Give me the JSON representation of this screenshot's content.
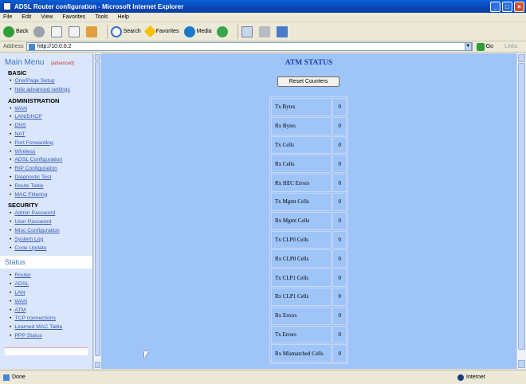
{
  "window": {
    "title": "ADSL Router configuration - Microsoft Internet Explorer"
  },
  "menubar": [
    "File",
    "Edit",
    "View",
    "Favorites",
    "Tools",
    "Help"
  ],
  "toolbar": {
    "back": "Back",
    "search": "Search",
    "favorites": "Favorites",
    "media": "Media"
  },
  "address": {
    "label": "Address",
    "url": "http://10.0.0.2",
    "go": "Go",
    "links": "Links"
  },
  "sidebar": {
    "title": "Main Menu",
    "tag": "(advanced)",
    "basic_label": "BASIC",
    "basic": [
      "One/Page Setup",
      "hide advanced settings"
    ],
    "admin_label": "ADMINISTRATION",
    "admin": [
      "WAN",
      "LAN/DHCP",
      "DNS",
      "NAT",
      "Port Forwarding",
      "Wireless",
      "ADSL Configuration",
      "RIP Configuration",
      "Diagnostic Test",
      "Route Table",
      "MAC Filtering"
    ],
    "security_label": "SECURITY",
    "security": [
      "Admin Password",
      "User Password",
      "Misc Configuration",
      "System Log",
      "Code Update"
    ],
    "status_label": "Status",
    "status": [
      "Router",
      "ADSL",
      "LAN",
      "WAN",
      "ATM",
      "TCP connections",
      "Learned MAC Table",
      "PPP Status"
    ]
  },
  "main": {
    "title": "ATM STATUS",
    "reset_button": "Reset Counters",
    "rows": [
      {
        "label": "Tx Bytes",
        "value": "0"
      },
      {
        "label": "Rx Bytes",
        "value": "0"
      },
      {
        "label": "Tx Cells",
        "value": "0"
      },
      {
        "label": "Rx Cells",
        "value": "0"
      },
      {
        "label": "Rx HEC Errors",
        "value": "0"
      },
      {
        "label": "Tx Mgmt Cells",
        "value": "0"
      },
      {
        "label": "Rx Mgmt Cells",
        "value": "0"
      },
      {
        "label": "Tx CLP0 Cells",
        "value": "0"
      },
      {
        "label": "Rx CLP0 Cells",
        "value": "0"
      },
      {
        "label": "Tx CLP1 Cells",
        "value": "0"
      },
      {
        "label": "Rx CLP1 Cells",
        "value": "0"
      },
      {
        "label": "Rx Errors",
        "value": "0"
      },
      {
        "label": "Tx Errors",
        "value": "0"
      },
      {
        "label": "Rx Mismatched Cells",
        "value": "0"
      }
    ]
  },
  "statusbar": {
    "left": "Done",
    "zone": "Internet"
  }
}
